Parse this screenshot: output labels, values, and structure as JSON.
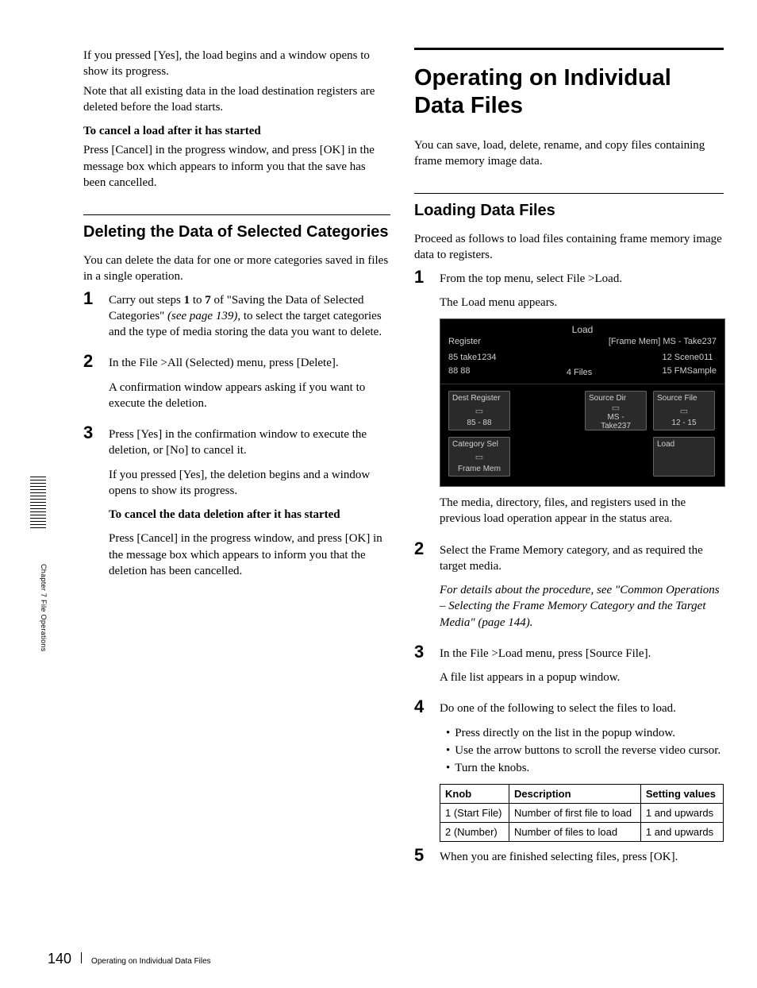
{
  "sidebar_label": "Chapter 7  File Operations",
  "footer": {
    "page": "140",
    "title": "Operating on Individual Data Files"
  },
  "left": {
    "intro1": "If you pressed [Yes], the load begins and a window opens to show its progress.",
    "intro2": "Note that all existing data in the load destination registers are deleted before the load starts.",
    "cancel_load_h": "To cancel a load after it has started",
    "cancel_load_p": "Press [Cancel] in the progress window, and press [OK] in the message box which appears to inform you that the save has been cancelled.",
    "h2": "Deleting the Data of Selected Categories",
    "h2_intro": "You can delete the data for one or more categories saved in files in a single operation.",
    "s1a": "Carry out steps ",
    "s1b": "1",
    "s1c": " to ",
    "s1d": "7",
    "s1e": " of \"Saving the Data of Selected Categories\" ",
    "s1f": "(see page 139)",
    "s1g": ", to select the target categories and the type of media storing the data you want to delete.",
    "s2": "In the File >All (Selected) menu, press [Delete].",
    "s2p": "A confirmation window appears asking if you want to execute the deletion.",
    "s3": "Press [Yes] in the confirmation window to execute the deletion, or [No] to cancel it.",
    "s3p": "If you pressed [Yes], the deletion begins and a window opens to show its progress.",
    "cancel_del_h": "To cancel the data deletion after it has started",
    "cancel_del_p": "Press [Cancel] in the progress window, and press [OK] in the message box which appears to inform you that the deletion has been cancelled."
  },
  "right": {
    "h1": "Operating on Individual Data Files",
    "intro": "You can save, load, delete, rename, and copy files containing frame memory image data.",
    "h2": "Loading Data Files",
    "h2_intro": "Proceed as follows to load files containing frame memory image data to registers.",
    "s1": "From the top menu, select File >Load.",
    "s1p": "The Load menu appears.",
    "ui": {
      "title": "Load",
      "reg_label": "Register",
      "reg_right": "[Frame Mem]  MS - Take237",
      "l1": "85  take1234",
      "l2": "88  88",
      "mid": "4 Files",
      "r1": "12  Scene011",
      "r2": "15  FMSample",
      "btn_dest": "Dest Register",
      "btn_dest_v": "85 -  88",
      "btn_srcdir": "Source Dir",
      "btn_srcdir_v": "MS -\nTake237",
      "btn_srcfile": "Source File",
      "btn_srcfile_v": "12 -  15",
      "btn_cat": "Category Sel",
      "btn_cat_v": "Frame Mem",
      "btn_load": "Load"
    },
    "after_ui": "The media, directory, files, and registers used in the previous load operation appear in the status area.",
    "s2": "Select the Frame Memory category, and as required the target media.",
    "s2i": "For details about the procedure, see \"Common Operations – Selecting the Frame Memory Category and the Target Media\" (page 144).",
    "s3": "In the File >Load menu, press [Source File].",
    "s3p": "A file list appears in a popup window.",
    "s4": "Do one of the following to select the files to load.",
    "s4b": [
      "Press directly on the list in the popup window.",
      "Use the arrow buttons to scroll the reverse video cursor.",
      "Turn the knobs."
    ],
    "table": {
      "h1": "Knob",
      "h2": "Description",
      "h3": "Setting values",
      "r1c1": "1 (Start File)",
      "r1c2": "Number of first file to load",
      "r1c3": "1 and upwards",
      "r2c1": "2 (Number)",
      "r2c2": "Number of files to load",
      "r2c3": "1 and upwards"
    },
    "s5": "When you are finished selecting files, press [OK]."
  }
}
